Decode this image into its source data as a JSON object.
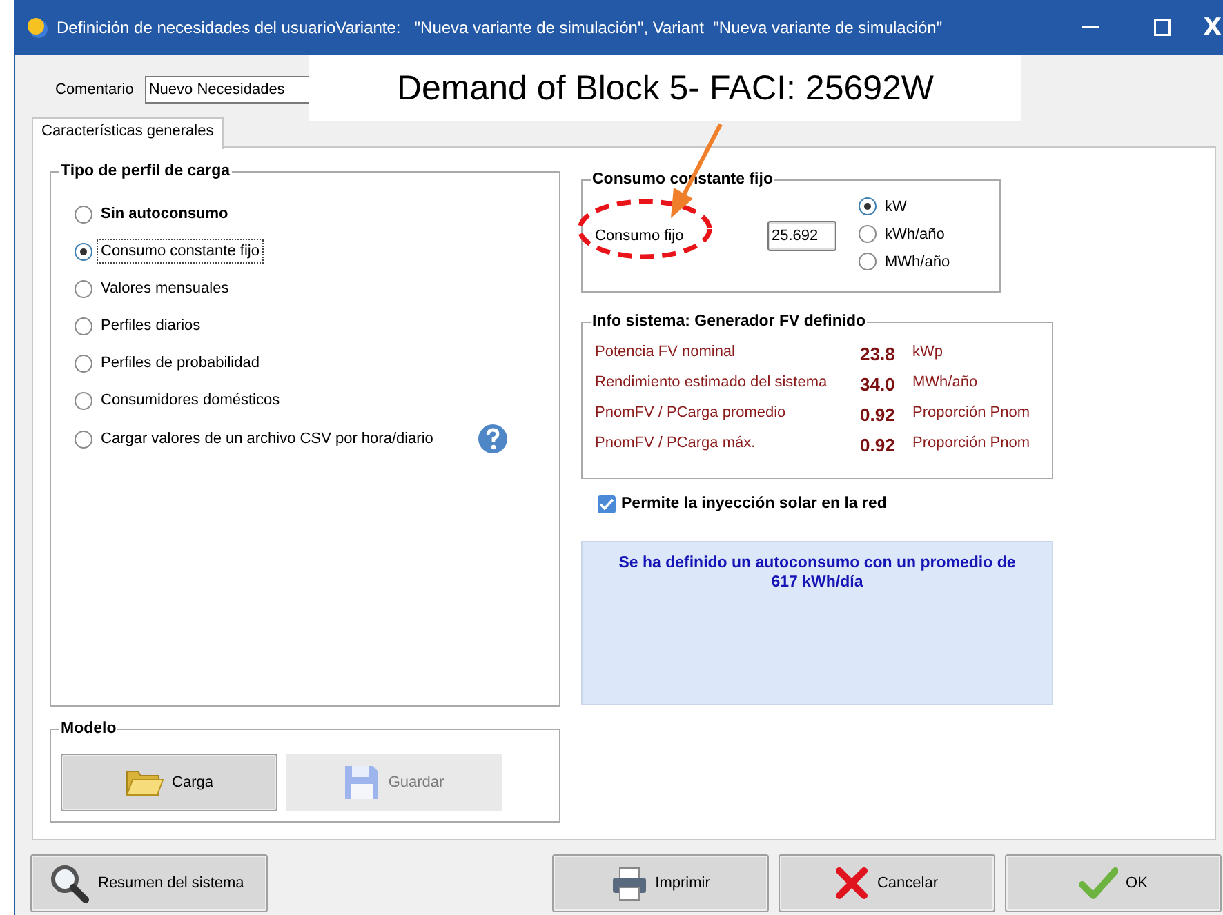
{
  "window": {
    "title": "Definición de necesidades del usuarioVariante:   \"Nueva variante de simulación\", Variant  \"Nueva variante de simulación\"",
    "close_label": "X"
  },
  "comment": {
    "label": "Comentario",
    "value": "Nuevo Necesidades"
  },
  "tabs": [
    {
      "label": "Características generales",
      "selected": true
    }
  ],
  "load_profile": {
    "title": "Tipo de perfil de carga",
    "options": [
      {
        "label": "Sin autoconsumo",
        "selected": false,
        "bold": true
      },
      {
        "label": "Consumo constante fijo",
        "selected": true,
        "bold": false
      },
      {
        "label": "Valores mensuales",
        "selected": false,
        "bold": false
      },
      {
        "label": "Perfiles diarios",
        "selected": false,
        "bold": false
      },
      {
        "label": "Perfiles de probabilidad",
        "selected": false,
        "bold": false
      },
      {
        "label": "Consumidores domésticos",
        "selected": false,
        "bold": false
      },
      {
        "label": "Cargar valores de un archivo CSV por hora/diario",
        "selected": false,
        "bold": false
      }
    ]
  },
  "constant": {
    "title": "Consumo constante fijo",
    "label": "Consumo fijo",
    "value": "25.692",
    "units": [
      {
        "label": "kW",
        "selected": true
      },
      {
        "label": "kWh/año",
        "selected": false
      },
      {
        "label": "MWh/año",
        "selected": false
      }
    ]
  },
  "info": {
    "title": "Info sistema: Generador FV definido",
    "rows": [
      {
        "label": "Potencia FV nominal",
        "value": "23.8",
        "unit": "kWp"
      },
      {
        "label": "Rendimiento estimado del sistema",
        "value": "34.0",
        "unit": "MWh/año"
      },
      {
        "label": "PnomFV / PCarga promedio",
        "value": "0.92",
        "unit": "Proporción Pnom"
      },
      {
        "label": "PnomFV / PCarga máx.",
        "value": "0.92",
        "unit": "Proporción Pnom"
      }
    ]
  },
  "injection": {
    "label": "Permite la inyección solar en la red",
    "checked": true
  },
  "message": "Se ha definido un autoconsumo con un promedio de 617 kWh/día",
  "model": {
    "title": "Modelo",
    "buttons": [
      {
        "label": "Carga",
        "kind": "open",
        "disabled": false
      },
      {
        "label": "Guardar",
        "kind": "save",
        "disabled": true
      }
    ]
  },
  "footer_buttons": [
    {
      "label": "Resumen del sistema",
      "kind": "search"
    },
    {
      "label": "Imprimir",
      "kind": "print"
    },
    {
      "label": "Cancelar",
      "kind": "cancel"
    },
    {
      "label": "OK",
      "kind": "ok"
    }
  ],
  "annotation": {
    "text": "Demand of Block 5- FACI: 25692W"
  }
}
